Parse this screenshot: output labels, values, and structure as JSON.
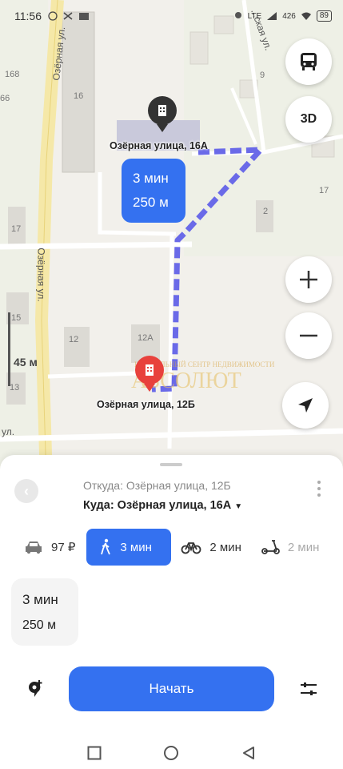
{
  "status_bar": {
    "time": "11:56",
    "signal_text": "426\nB/S",
    "network": "LTE",
    "battery": "89"
  },
  "map": {
    "streets": {
      "ozernaya_top": "Озёрная ул.",
      "ozernaya_mid": "Озёрная ул.",
      "right_street": "...ская ул.",
      "bottom_left": "ул."
    },
    "houses": {
      "h168": "168",
      "h66": "66",
      "h16": "16",
      "h17a": "17",
      "h17b": "17",
      "h2": "2",
      "h15": "15",
      "h12": "12",
      "h12a": "12А",
      "h13": "13",
      "h9": "9"
    },
    "destination_label": "Озёрная улица, 16А",
    "origin_label": "Озёрная улица, 12Б",
    "route_time": "3 мин",
    "route_distance": "250 м",
    "scale_label": "45 м",
    "btn_3d": "3D",
    "watermark": "АБСОЛЮТ",
    "watermark_small": "ЦИОНАЛЬНЫЙ СЕНТР НЕДВИЖИМОСТИ"
  },
  "sheet": {
    "from": "Откуда: Озёрная улица, 12Б",
    "to": "Куда: Озёрная улица, 16А",
    "to_caret": "▼",
    "back_icon": "‹",
    "modes": [
      {
        "label": "97 ₽"
      },
      {
        "label": "3 мин"
      },
      {
        "label": "2 мин"
      },
      {
        "label": "2 мин"
      }
    ],
    "summary_time": "3 мин",
    "summary_distance": "250 м",
    "start_label": "Начать"
  },
  "colors": {
    "accent": "#3471f0",
    "route": "#6a6ae8",
    "origin_pin": "#e8413c",
    "dest_pin": "#333333"
  }
}
